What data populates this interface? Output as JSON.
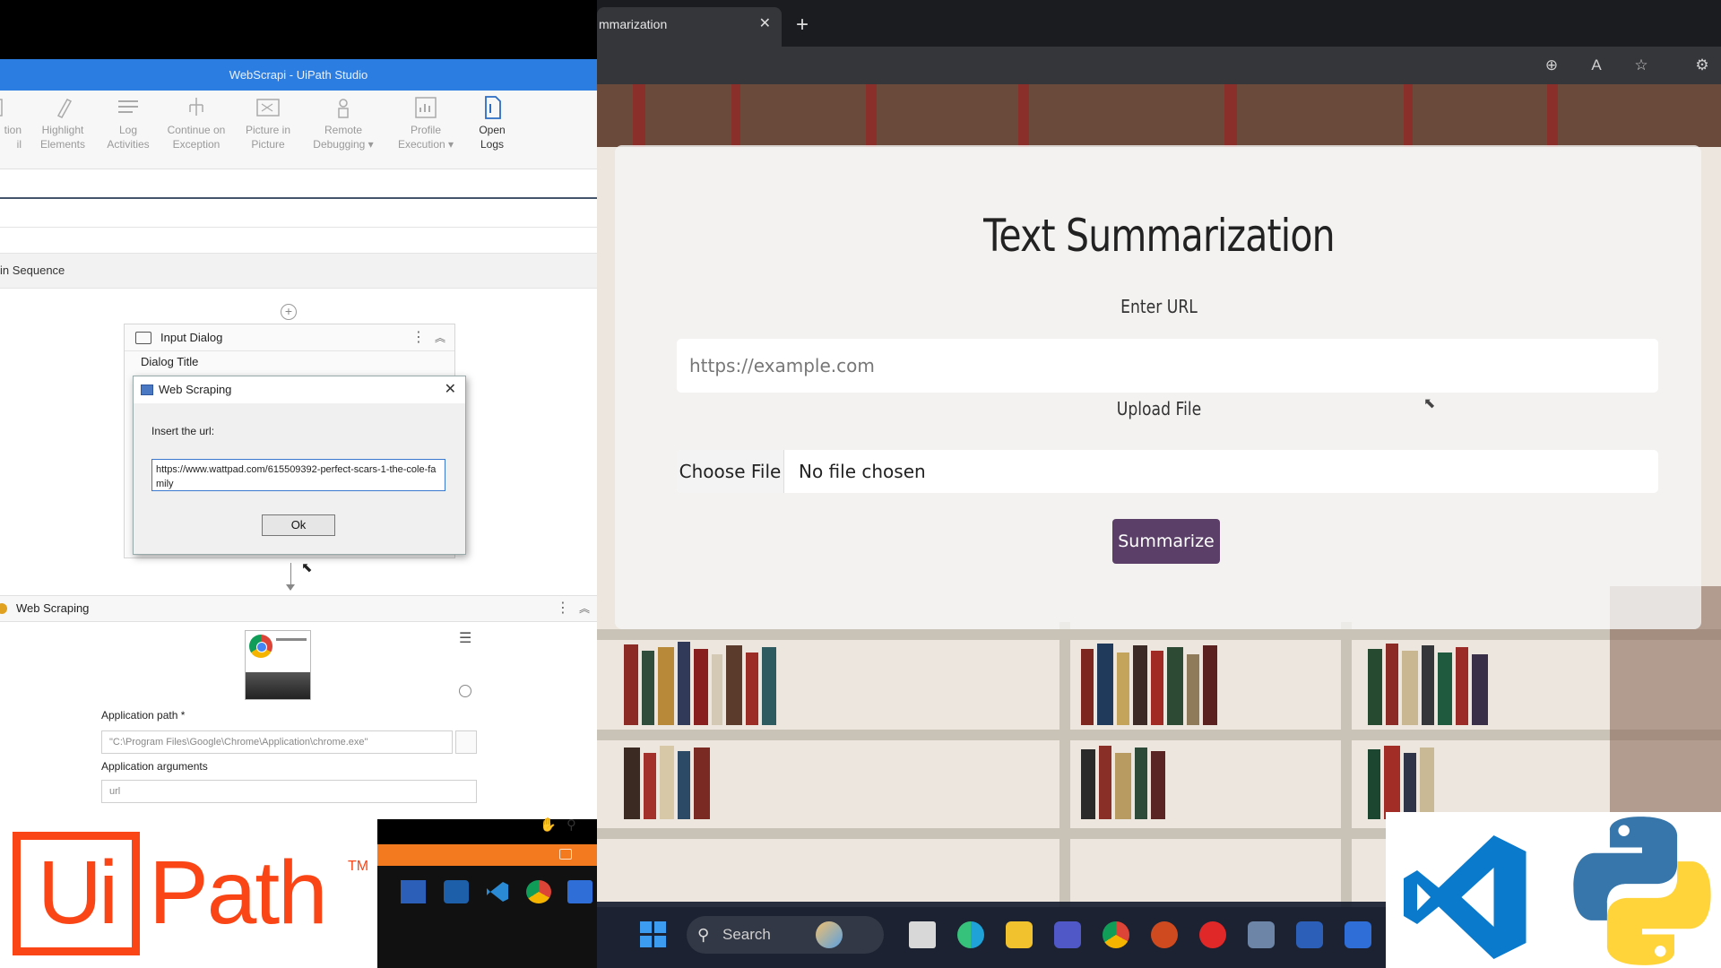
{
  "studio": {
    "title": "WebScrapi - UiPath Studio",
    "ribbon": [
      {
        "label": "tion\nil"
      },
      {
        "label": "Highlight\nElements"
      },
      {
        "label": "Log\nActivities"
      },
      {
        "label": "Continue on\nException"
      },
      {
        "label": "Picture in\nPicture"
      },
      {
        "label": "Remote\nDebugging ▾"
      },
      {
        "label": "Profile\nExecution ▾"
      },
      {
        "label": "Open\nLogs"
      }
    ],
    "sequence_label": "in Sequence",
    "input_dialog": {
      "title": "Input Dialog",
      "dialog_title_label": "Dialog Title"
    },
    "win_dialog": {
      "title": "Web Scraping",
      "prompt": "Insert the url:",
      "value": "https://www.wattpad.com/615509392-perfect-scars-1-the-cole-family",
      "ok": "Ok"
    },
    "web_scraping": {
      "title": "Web Scraping",
      "app_path_label": "Application path *",
      "app_path_value": "\"C:\\Program Files\\Google\\Chrome\\Application\\chrome.exe\"",
      "app_args_label": "Application arguments",
      "app_args_value": "url"
    }
  },
  "uipath_logo": {
    "ui": "Ui",
    "path": "Path",
    "tm": "TM"
  },
  "browser": {
    "tab_title": "mmarization",
    "page": {
      "heading": "Text Summarization",
      "url_label": "Enter URL",
      "url_placeholder": "https://example.com",
      "upload_label": "Upload File",
      "choose_file": "Choose File",
      "no_file": "No file chosen",
      "submit": "Summarize"
    }
  },
  "taskbar": {
    "search": "Search"
  },
  "colors": {
    "uipath_orange": "#fa4616",
    "studio_blue": "#2b7de1",
    "button_purple": "#5b3f68",
    "vscode_blue": "#0a7acc",
    "python_blue": "#3776ab",
    "python_yellow": "#ffd43b"
  }
}
